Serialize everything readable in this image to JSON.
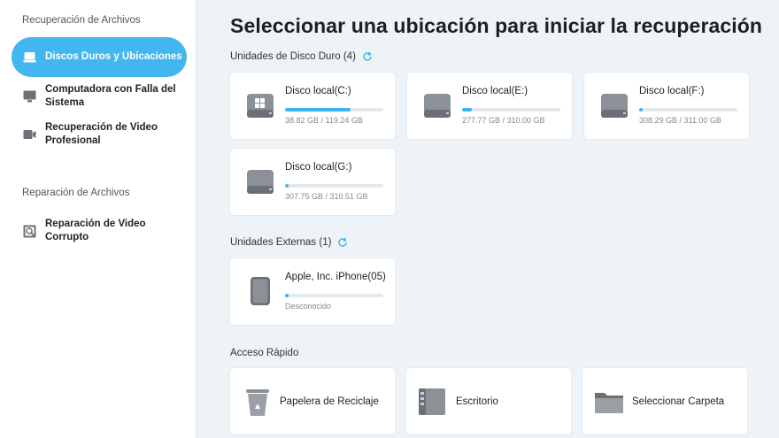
{
  "sidebar": {
    "section_recovery": "Recuperación de Archivos",
    "items": [
      {
        "label": "Discos Duros y Ubicaciones"
      },
      {
        "label": "Computadora con Falla del Sistema"
      },
      {
        "label": "Recuperación de Video Profesional"
      }
    ],
    "section_repair": "Reparación de Archivos",
    "repair_items": [
      {
        "label": "Reparación de Video Corrupto"
      }
    ]
  },
  "main": {
    "title": "Seleccionar una ubicación para iniciar la recuperación",
    "hard_drives_label": "Unidades de Disco Duro (4)",
    "drives": [
      {
        "name": "Disco local(C:)",
        "size": "38.82 GB / 119.24 GB",
        "used_fraction": 0.67,
        "icon": "windows-drive-icon"
      },
      {
        "name": "Disco local(E:)",
        "size": "277.77 GB / 310.00 GB",
        "used_fraction": 0.1,
        "icon": "hard-drive-icon"
      },
      {
        "name": "Disco local(F:)",
        "size": "308.29 GB / 311.00 GB",
        "used_fraction": 0.04,
        "icon": "hard-drive-icon"
      },
      {
        "name": "Disco local(G:)",
        "size": "307.75 GB / 310.51 GB",
        "used_fraction": 0.04,
        "icon": "hard-drive-icon"
      }
    ],
    "external_label": "Unidades Externas (1)",
    "external": [
      {
        "name": "Apple, Inc. iPhone(05)",
        "size": "Desconocido",
        "used_fraction": 0.04,
        "icon": "phone-icon"
      }
    ],
    "quick_label": "Acceso Rápido",
    "quick": [
      {
        "label": "Papelera de Reciclaje",
        "icon": "recycle-bin-icon"
      },
      {
        "label": "Escritorio",
        "icon": "desktop-icon"
      },
      {
        "label": "Seleccionar Carpeta",
        "icon": "folder-icon"
      }
    ]
  },
  "colors": {
    "accent": "#42b7ef",
    "bar_fill": "#3bb5ee",
    "background": "#eef3f8"
  }
}
